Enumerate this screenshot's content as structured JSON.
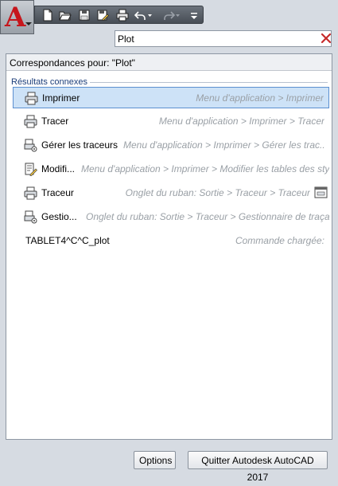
{
  "app_button": {
    "letter": "A",
    "icon": "autocad-logo-icon"
  },
  "quick_access": {
    "items": [
      {
        "name": "new-icon"
      },
      {
        "name": "open-icon"
      },
      {
        "name": "save-icon"
      },
      {
        "name": "save-as-icon"
      },
      {
        "name": "plot-icon"
      },
      {
        "name": "undo-icon"
      },
      {
        "name": "redo-icon"
      },
      {
        "name": "customize-icon"
      }
    ]
  },
  "search": {
    "value": "Plot",
    "clear_icon": "clear-search-icon"
  },
  "results": {
    "header": "Correspondances pour: \"Plot\"",
    "group_label": "Résultats connexes",
    "items": [
      {
        "label": "Imprimer",
        "path": "Menu d'application > Imprimer",
        "icon": "printer-icon",
        "selected": true
      },
      {
        "label": "Tracer",
        "path": "Menu d'application > Imprimer > Tracer",
        "icon": "printer-icon"
      },
      {
        "label": "Gérer les traceurs",
        "path": "Menu d'application > Imprimer > Gérer les trac...",
        "icon": "plotter-manager-icon"
      },
      {
        "label": "Modifi...",
        "path": "Menu d'application > Imprimer > Modifier les tables des sty",
        "icon": "edit-plot-style-icon"
      },
      {
        "label": "Traceur",
        "path": "Onglet du ruban: Sortie > Traceur > Traceur",
        "icon": "printer-icon",
        "trailing_icon": "ribbon-panel-icon"
      },
      {
        "label": "Gestio...",
        "path": "Onglet du ruban: Sortie > Traceur > Gestionnaire de traçag",
        "icon": "plotter-manager-icon"
      },
      {
        "label": "TABLET4^C^C_plot",
        "path": "Commande chargée:",
        "icon": null
      }
    ]
  },
  "buttons": {
    "options": "Options",
    "quit": "Quitter Autodesk AutoCAD 2017"
  },
  "colors": {
    "brand_red": "#c6161c",
    "selection_bg": "#cde2f7",
    "selection_border": "#5b8fd0"
  }
}
